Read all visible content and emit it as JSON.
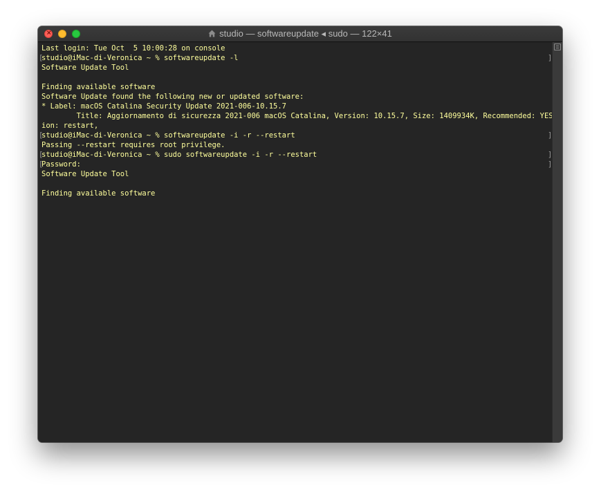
{
  "window": {
    "title": "studio — softwareupdate ◂ sudo — 122×41"
  },
  "icons": {
    "close": "close-icon",
    "minimize": "minimize-icon",
    "zoom": "zoom-icon",
    "home": "home-icon",
    "scrollbar": "scrollbar-list-icon"
  },
  "colors": {
    "terminal_background": "#252525",
    "terminal_text": "#ffff9d",
    "close": "#ff5f57",
    "minimize": "#febc2e",
    "zoom": "#28c840"
  },
  "terminal": {
    "lines": [
      "Last login: Tue Oct  5 10:00:28 on console",
      "studio@iMac-di-Veronica ~ % softwareupdate -l",
      "Software Update Tool",
      "",
      "Finding available software",
      "Software Update found the following new or updated software:",
      "* Label: macOS Catalina Security Update 2021-006-10.15.7",
      "\tTitle: Aggiornamento di sicurezza 2021-006 macOS Catalina, Version: 10.15.7, Size: 1409934K, Recommended: YES, Act",
      "ion: restart,",
      "studio@iMac-di-Veronica ~ % softwareupdate -i -r --restart",
      "Passing --restart requires root privilege.",
      "studio@iMac-di-Veronica ~ % sudo softwareupdate -i -r --restart",
      "Password:",
      "Software Update Tool",
      "",
      "Finding available software"
    ],
    "bracket_left": "[",
    "bracket_right": "]"
  }
}
